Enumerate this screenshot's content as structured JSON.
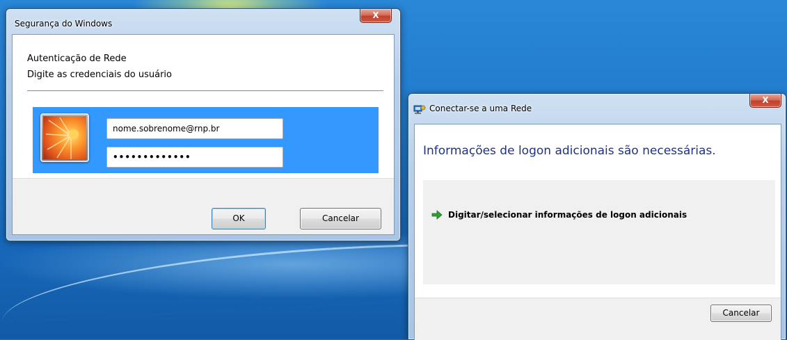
{
  "dialog_security": {
    "title": "Segurança do Windows",
    "close_label": "X",
    "heading": "Autenticação de Rede",
    "subheading": "Digite as credenciais do usuário",
    "username_value": "nome.sobrenome@rnp.br",
    "password_value": "•••••••••••••",
    "ok_label": "OK",
    "cancel_label": "Cancelar"
  },
  "dialog_network": {
    "title": "Conectar-se a uma Rede",
    "close_label": "X",
    "heading": "Informações de logon adicionais são necessárias.",
    "option_label": "Digitar/selecionar informações de logon adicionais",
    "cancel_label": "Cancelar"
  },
  "colors": {
    "credential_band": "#3399ff",
    "heading_blue": "#1e3287",
    "arrow_green": "#2f9e33"
  },
  "icons": [
    "network-icon",
    "green-arrow-icon",
    "user-avatar-flower",
    "close-icon"
  ]
}
